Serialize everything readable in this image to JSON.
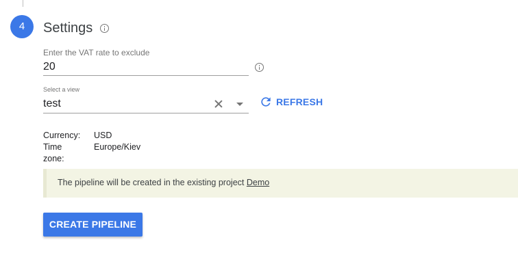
{
  "step": {
    "number": "4",
    "title": "Settings"
  },
  "vat_field": {
    "label": "Enter the VAT rate to exclude",
    "value": "20"
  },
  "view_select": {
    "label": "Select a view",
    "value": "test"
  },
  "refresh": {
    "label": "REFRESH"
  },
  "meta": {
    "currency_key": "Currency:",
    "currency_value": "USD",
    "timezone_key": "Time zone:",
    "timezone_value": "Europe/Kiev"
  },
  "notice": {
    "text": "The pipeline will be created in the existing project ",
    "link": "Demo"
  },
  "create_button": {
    "label": "CREATE PIPELINE"
  },
  "colors": {
    "accent": "#3b78e7",
    "notice_bg": "#f3f4e4"
  },
  "icons": [
    "info-icon",
    "clear-icon",
    "dropdown-caret-icon",
    "refresh-icon"
  ]
}
